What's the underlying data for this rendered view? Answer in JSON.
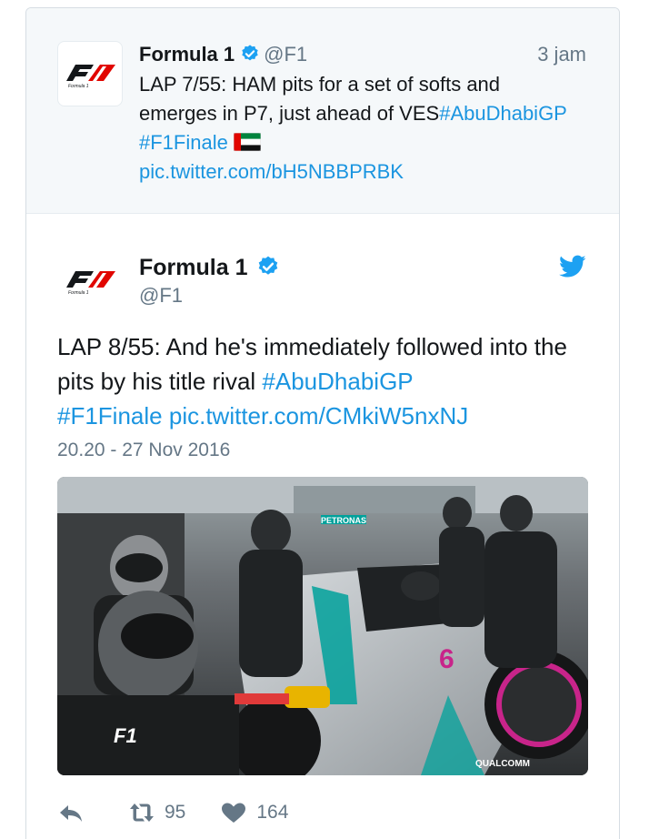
{
  "parent_tweet": {
    "author_name": "Formula 1",
    "handle": "@F1",
    "time": "3 jam",
    "text_plain": "LAP 7/55: HAM pits for a set of softs and emerges in P7, just ahead of VES",
    "hashtag_1": "#AbuDhabiGP",
    "hashtag_2": "#F1Finale",
    "pic_link": "pic.twitter.com/bH5NBBPRBK",
    "flag_icon": "uae-flag-icon"
  },
  "main_tweet": {
    "author_name": "Formula 1",
    "handle": "@F1",
    "text_plain": "LAP 8/55: And he's immediately followed into the pits by his title rival",
    "hashtag_1": "#AbuDhabiGP",
    "hashtag_2": "#F1Finale",
    "pic_link": "pic.twitter.com/CMkiW5nxNJ",
    "date": "20.20 - 27 Nov 2016",
    "media_alt": "Mercedes pit crew changing tyres during pit stop",
    "media_text": {
      "brand": "QUALCOMM",
      "car_number": "6",
      "watermark": "F1",
      "sponsor": "PETRONAS"
    },
    "actions": {
      "reply_icon": "reply-icon",
      "retweet_icon": "retweet-icon",
      "retweet_count": "95",
      "like_icon": "heart-icon",
      "like_count": "164"
    }
  },
  "colors": {
    "link": "#1b95e0",
    "verified": "#1da1f2",
    "muted": "#657786",
    "f1_red": "#e10600"
  }
}
